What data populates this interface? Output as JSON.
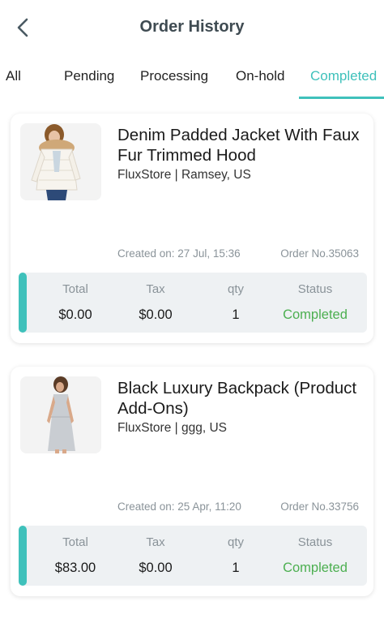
{
  "header": {
    "title": "Order History",
    "back_icon": "chevron-left-icon"
  },
  "tabs": [
    {
      "label": "All",
      "active": false
    },
    {
      "label": "Pending",
      "active": false
    },
    {
      "label": "Processing",
      "active": false
    },
    {
      "label": "On-hold",
      "active": false
    },
    {
      "label": "Completed",
      "active": true
    }
  ],
  "colors": {
    "accent": "#3fc1bb",
    "status_completed": "#4caf50"
  },
  "labels": {
    "total": "Total",
    "tax": "Tax",
    "qty": "qty",
    "status": "Status"
  },
  "orders": [
    {
      "product_name": "Denim Padded Jacket With Faux Fur Trimmed Hood",
      "store": "FluxStore | Ramsey, US",
      "created": "Created on: 27 Jul, 15:36",
      "order_no": "Order No.35063",
      "total": "$0.00",
      "tax": "$0.00",
      "qty": "1",
      "status": "Completed"
    },
    {
      "product_name": "Black Luxury Backpack (Product Add-Ons)",
      "store": "FluxStore | ggg, US",
      "created": "Created on: 25 Apr, 11:20",
      "order_no": "Order No.33756",
      "total": "$83.00",
      "tax": "$0.00",
      "qty": "1",
      "status": "Completed"
    }
  ]
}
